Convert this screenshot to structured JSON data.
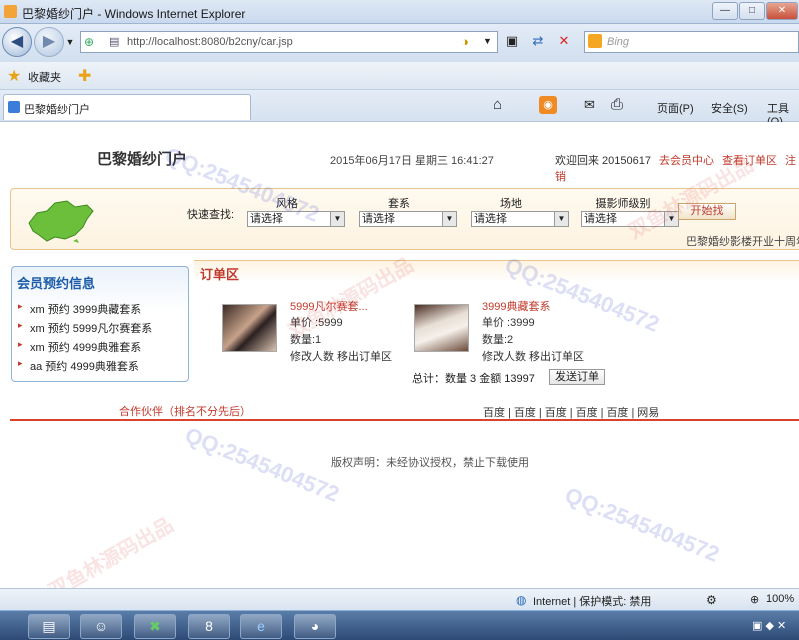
{
  "window": {
    "title": "巴黎婚纱门户 - Windows Internet Explorer",
    "min": "—",
    "max": "□",
    "close": "✕"
  },
  "browser": {
    "url": "http://localhost:8080/b2cny/car.jsp",
    "search_placeholder": "Bing",
    "favorites": "收藏夹",
    "tab_title": "巴黎婚纱门户",
    "page_menu": "页面(P)",
    "safety_menu": "安全(S)",
    "tools_menu": "工具(O)"
  },
  "header": {
    "site_title": "巴黎婚纱门户",
    "datetime": "2015年06月17日 星期三 16:41:27",
    "welcome": "欢迎回来 20150617",
    "member_center": "去会员中心",
    "view_orders": "查看订单区",
    "logout": "注销"
  },
  "quick_search": {
    "label": "快速查找:",
    "filters": [
      {
        "label": "风格",
        "value": "请选择"
      },
      {
        "label": "套系",
        "value": "请选择"
      },
      {
        "label": "场地",
        "value": "请选择"
      },
      {
        "label": "摄影师级别",
        "value": "请选择"
      }
    ],
    "start_button": "开始找",
    "ticker": "巴黎婚纱影楼开业十周年"
  },
  "sidebar": {
    "title": "会员预约信息",
    "items": [
      "xm 预约 3999典藏套系",
      "xm 预约 5999凡尔赛套系",
      "xm 预约 4999典雅套系",
      "aa 预约 4999典雅套系"
    ]
  },
  "orders": {
    "title": "订单区",
    "items": [
      {
        "name": "5999凡尔赛套...",
        "price": "单价 :5999",
        "qty": "数量:1",
        "actions": "修改人数 移出订单区"
      },
      {
        "name": "3999典藏套系",
        "price": "单价 :3999",
        "qty": "数量:2",
        "actions": "修改人数 移出订单区"
      }
    ],
    "total": "总计：数量  3  金额  13997",
    "send_button": "发送订单"
  },
  "footer": {
    "partners": "合作伙伴（排名不分先后）",
    "links": [
      "百度",
      "|",
      "百度",
      "|",
      "百度",
      "|",
      "百度",
      "|",
      "百度",
      "|",
      "网易"
    ],
    "copyright": "版权声明：未经协议授权，禁止下载使用"
  },
  "status": {
    "zone": "Internet | 保护模式: 禁用",
    "zoom": "100%"
  },
  "watermark": {
    "text1": "QQ:2545404572",
    "text2": "双鱼林源码出品"
  }
}
